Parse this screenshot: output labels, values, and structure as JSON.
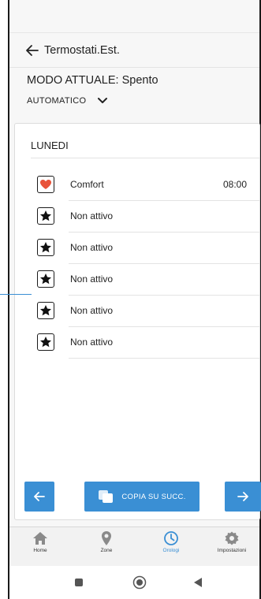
{
  "appbar": {
    "title": "Termostati.Est."
  },
  "mode": {
    "text": "MODO ATTUALE: Spento"
  },
  "program_select": {
    "value": "AUTOMATICO"
  },
  "schedule": {
    "day": "LUNEDI",
    "rows": [
      {
        "label": "Comfort",
        "time": "08:00",
        "icon": "heart-icon"
      },
      {
        "label": "Non attivo",
        "time": "",
        "icon": "star-icon"
      },
      {
        "label": "Non attivo",
        "time": "",
        "icon": "star-icon"
      },
      {
        "label": "Non attivo",
        "time": "",
        "icon": "star-icon"
      },
      {
        "label": "Non attivo",
        "time": "",
        "icon": "star-icon"
      },
      {
        "label": "Non attivo",
        "time": "",
        "icon": "star-icon"
      }
    ]
  },
  "actions": {
    "copy_label": "COPIA SU SUCC."
  },
  "bottom_nav": {
    "items": [
      {
        "label": "Home",
        "icon": "home-icon"
      },
      {
        "label": "Zone",
        "icon": "location-pin-icon"
      },
      {
        "label": "Orologi",
        "icon": "clock-icon",
        "active": true
      },
      {
        "label": "Impostazioni",
        "icon": "gear-icon"
      }
    ]
  },
  "colors": {
    "accent": "#3a8fd4",
    "heart": "#e8533a",
    "nav_icon": "#8a8a8a"
  }
}
